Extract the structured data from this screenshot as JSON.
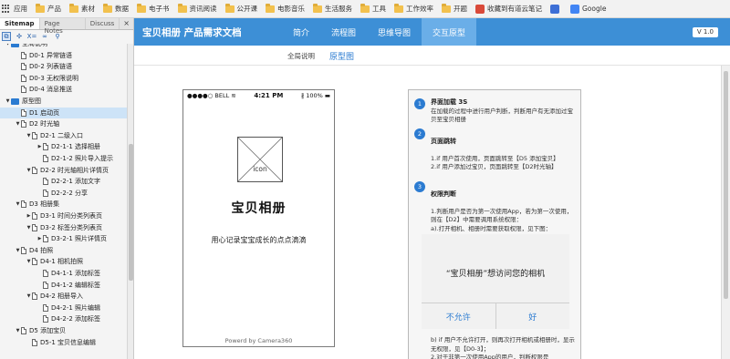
{
  "bookmarks": [
    {
      "label": "应用",
      "kind": "apps"
    },
    {
      "label": "产品",
      "kind": "folder"
    },
    {
      "label": "素材",
      "kind": "folder"
    },
    {
      "label": "数据",
      "kind": "folder"
    },
    {
      "label": "电子书",
      "kind": "folder"
    },
    {
      "label": "资讯阅读",
      "kind": "folder"
    },
    {
      "label": "公开课",
      "kind": "folder"
    },
    {
      "label": "电影音乐",
      "kind": "folder"
    },
    {
      "label": "生活服务",
      "kind": "folder"
    },
    {
      "label": "工具",
      "kind": "folder"
    },
    {
      "label": "工作效率",
      "kind": "folder"
    },
    {
      "label": "开题",
      "kind": "folder"
    },
    {
      "label": "收藏到有道云笔记",
      "kind": "fav",
      "color": "#d94a3a"
    },
    {
      "label": "",
      "kind": "fav",
      "color": "#3d6fd6"
    },
    {
      "label": "Google",
      "kind": "fav",
      "color": "#4285f4"
    }
  ],
  "sidebar": {
    "tabs": [
      "Sitemap",
      "Page Notes",
      "Discuss"
    ],
    "close": "×",
    "tools": [
      "⧉",
      "✣",
      "X=",
      "∞",
      "⚲"
    ],
    "tree": [
      {
        "label": "全局说明",
        "depth": 0,
        "kind": "folder",
        "expanded": true
      },
      {
        "label": "D0-1 异常链语",
        "depth": 1,
        "kind": "doc"
      },
      {
        "label": "D0-2 列表链语",
        "depth": 1,
        "kind": "doc"
      },
      {
        "label": "D0-3 无权限说明",
        "depth": 1,
        "kind": "doc"
      },
      {
        "label": "D0-4 消息推送",
        "depth": 1,
        "kind": "doc"
      },
      {
        "label": "原型图",
        "depth": 0,
        "kind": "folder",
        "expanded": true
      },
      {
        "label": "D1 启动页",
        "depth": 1,
        "kind": "doc",
        "selected": true
      },
      {
        "label": "D2 时光轴",
        "depth": 1,
        "kind": "doc",
        "expanded": true
      },
      {
        "label": "D2-1 二级入口",
        "depth": 2,
        "kind": "doc",
        "expanded": true
      },
      {
        "label": "D2-1-1 选择相册",
        "depth": 3,
        "kind": "doc",
        "collapsed": true
      },
      {
        "label": "D2-1-2 照片导入提示",
        "depth": 3,
        "kind": "doc"
      },
      {
        "label": "D2-2 时光轴相片详情页",
        "depth": 2,
        "kind": "doc",
        "expanded": true
      },
      {
        "label": "D2-2-1 添加文字",
        "depth": 3,
        "kind": "doc"
      },
      {
        "label": "D2-2-2 分享",
        "depth": 3,
        "kind": "doc"
      },
      {
        "label": "D3 相册集",
        "depth": 1,
        "kind": "doc",
        "expanded": true
      },
      {
        "label": "D3-1 时间分类列表页",
        "depth": 2,
        "kind": "doc",
        "collapsed": true
      },
      {
        "label": "D3-2 标签分类列表页",
        "depth": 2,
        "kind": "doc",
        "expanded": true
      },
      {
        "label": "D3-2-1 照片详情页",
        "depth": 3,
        "kind": "doc",
        "collapsed": true
      },
      {
        "label": "D4 拍照",
        "depth": 1,
        "kind": "doc",
        "expanded": true
      },
      {
        "label": "D4-1 相机拍照",
        "depth": 2,
        "kind": "doc",
        "expanded": true
      },
      {
        "label": "D4-1-1 添加标签",
        "depth": 3,
        "kind": "doc"
      },
      {
        "label": "D4-1-2 编辑标签",
        "depth": 3,
        "kind": "doc"
      },
      {
        "label": "D4-2 相册导入",
        "depth": 2,
        "kind": "doc",
        "expanded": true
      },
      {
        "label": "D4-2-1 照片编辑",
        "depth": 3,
        "kind": "doc"
      },
      {
        "label": "D4-2-2 添加标签",
        "depth": 3,
        "kind": "doc"
      },
      {
        "label": "D5 添加宝贝",
        "depth": 1,
        "kind": "doc",
        "expanded": true
      },
      {
        "label": "D5-1 宝贝信息编辑",
        "depth": 2,
        "kind": "doc"
      }
    ]
  },
  "header": {
    "title": "宝贝相册  产品需求文档",
    "nav": [
      "简介",
      "流程图",
      "思维导图",
      "交互原型"
    ],
    "active_nav": 3,
    "version": "V 1.0"
  },
  "subnav": {
    "items": [
      "全局说明",
      "原型图"
    ],
    "active": 1
  },
  "phone": {
    "carrier": "●●●●○ BELL ≋",
    "time": "4:21 PM",
    "battery": "∦ 100% ▬",
    "icon_label": "icon",
    "title": "宝贝相册",
    "subtitle": "用心记录宝宝成长的点点滴滴",
    "footer": "Powerd by Camera360"
  },
  "notes": {
    "steps": [
      {
        "num": "1",
        "title": "界面加载 3S",
        "text": "在加载的过程中进行用户判断，判断用户有无添加过宝贝至宝贝相册"
      },
      {
        "num": "2",
        "title": "页面跳转",
        "text": "1.if 用户首次使用，页面跳转至【D5 添加宝贝】\n2.if 用户添加过宝贝，页面跳转至【D2时光轴】"
      },
      {
        "num": "3",
        "title": "权限判断",
        "text": "1.判断用户是否为第一次使用App，若为第一次使用，则在【D2】中需要调用系统权限：\na).打开相机、相册时需要获取权限，见下图："
      }
    ],
    "dialog": {
      "text": "“宝贝相册”想访问您的相机",
      "deny": "不允许",
      "allow": "好"
    },
    "tail": "b) if 用户不允许打开，则再次打开相机或相册时，显示无权限，见【D0-3】；\n2.对于非第一次使用App的用户，判断权限是"
  }
}
